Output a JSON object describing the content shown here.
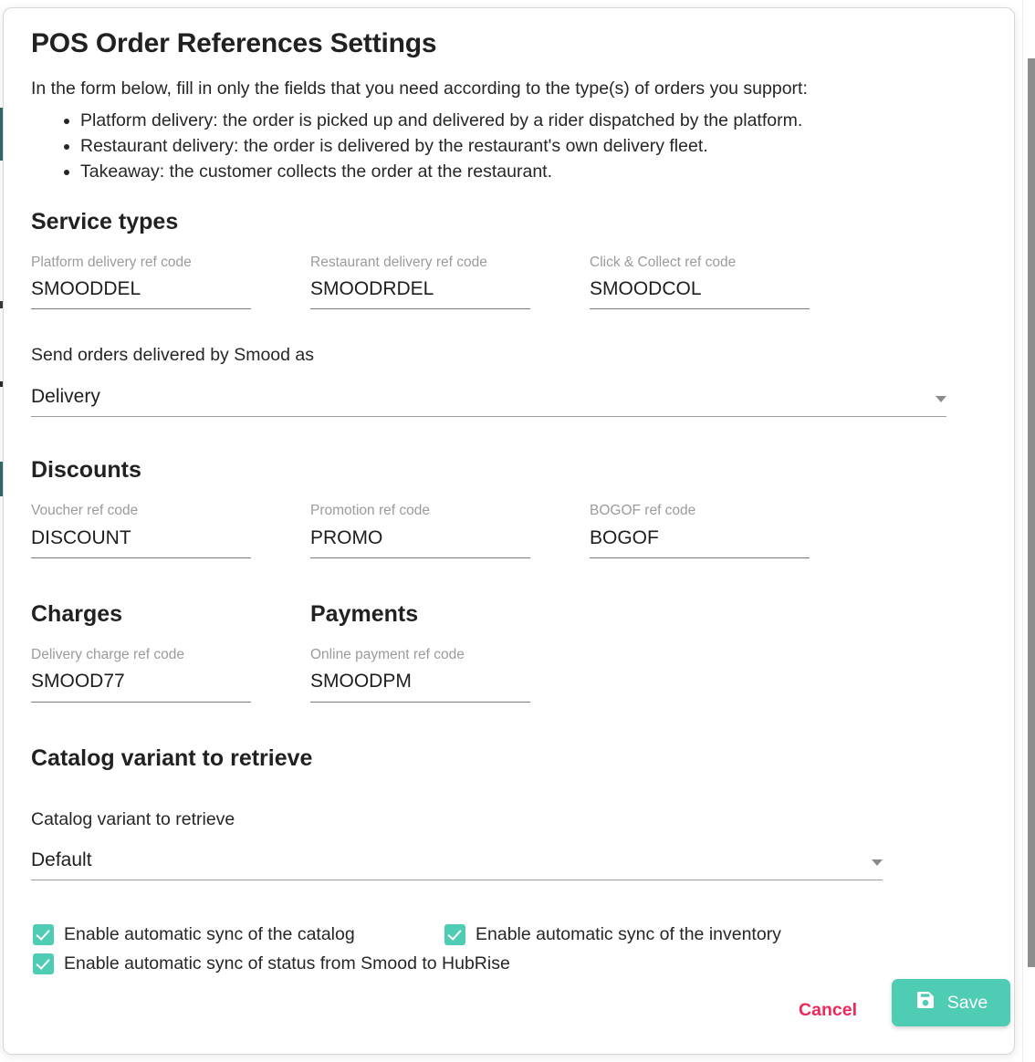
{
  "dialog": {
    "title": "POS Order References Settings",
    "intro": "In the form below, fill in only the fields that you need according to the type(s) of orders you support:",
    "bullets": [
      "Platform delivery: the order is picked up and delivered by a rider dispatched by the platform.",
      "Restaurant delivery: the order is delivered by the restaurant's own delivery fleet.",
      "Takeaway: the customer collects the order at the restaurant."
    ]
  },
  "service_types": {
    "heading": "Service types",
    "fields": [
      {
        "label": "Platform delivery ref code",
        "value": "SMOODDEL"
      },
      {
        "label": "Restaurant delivery ref code",
        "value": "SMOODRDEL"
      },
      {
        "label": "Click & Collect ref code",
        "value": "SMOODCOL"
      }
    ],
    "send_as": {
      "label": "Send orders delivered by Smood as",
      "value": "Delivery",
      "arrow_icon": "chevron-down-icon"
    }
  },
  "discounts": {
    "heading": "Discounts",
    "fields": [
      {
        "label": "Voucher ref code",
        "value": "DISCOUNT"
      },
      {
        "label": "Promotion ref code",
        "value": "PROMO"
      },
      {
        "label": "BOGOF ref code",
        "value": "BOGOF"
      }
    ]
  },
  "charges": {
    "heading": "Charges",
    "fields": [
      {
        "label": "Delivery charge ref code",
        "value": "SMOOD77"
      }
    ]
  },
  "payments": {
    "heading": "Payments",
    "fields": [
      {
        "label": "Online payment ref code",
        "value": "SMOODPM"
      }
    ]
  },
  "catalog_variant": {
    "heading": "Catalog variant to retrieve",
    "select": {
      "label": "Catalog variant to retrieve",
      "value": "Default",
      "arrow_icon": "chevron-down-icon"
    }
  },
  "sync_options": [
    {
      "label": "Enable automatic sync of the catalog",
      "checked": true
    },
    {
      "label": "Enable automatic sync of the inventory",
      "checked": true
    },
    {
      "label": "Enable automatic sync of status from Smood to HubRise",
      "checked": true
    }
  ],
  "footer": {
    "cancel_label": "Cancel",
    "save_label": "Save",
    "save_icon": "save-floppy-icon"
  },
  "colors": {
    "accent_teal": "#4ECDB4",
    "cancel_pink": "#F0285A",
    "page_strip_teal": "#2E6C6C",
    "text_primary": "#262626",
    "label_grey": "#9B9B9B"
  }
}
